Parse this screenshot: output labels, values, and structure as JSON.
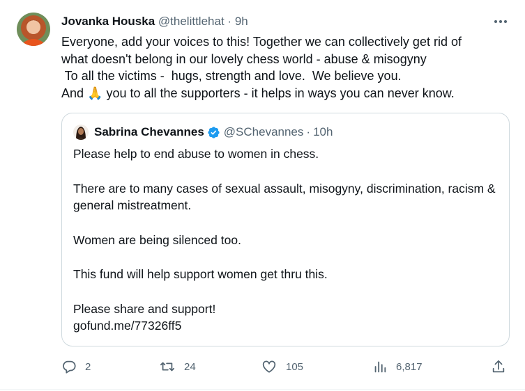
{
  "author": {
    "display_name": "Jovanka Houska",
    "handle": "@thelittlehat",
    "separator": "·",
    "time": "9h"
  },
  "tweet": {
    "lines": [
      "Everyone, add your voices to this! Together we can collectively get rid of",
      "what doesn't belong in our lovely chess world - abuse & misogyny",
      " To all the victims -  hugs, strength and love.  We believe you.",
      "you to all the supporters - it helps in ways you can never know."
    ],
    "line4_prefix": "And",
    "emoji": "🙏"
  },
  "quote": {
    "display_name": "Sabrina Chevannes",
    "handle": "@SChevannes",
    "separator": "·",
    "time": "10h",
    "paragraphs": [
      "Please help to end abuse to women in chess.",
      "There are to many cases of sexual assault, misogyny, discrimination, racism & general mistreatment.",
      "Women are being silenced too.",
      "This fund will help support women get thru this.",
      "Please share and support!"
    ],
    "link": "gofund.me/77326ff5"
  },
  "actions": {
    "replies": "2",
    "retweets": "24",
    "likes": "105",
    "views": "6,817"
  },
  "colors": {
    "text": "#0f1419",
    "secondary": "#536471",
    "border": "#cfd9de",
    "verified": "#1d9bf0"
  },
  "icons": [
    "more-icon",
    "verified-icon",
    "reply-icon",
    "retweet-icon",
    "like-icon",
    "views-icon",
    "share-icon"
  ]
}
